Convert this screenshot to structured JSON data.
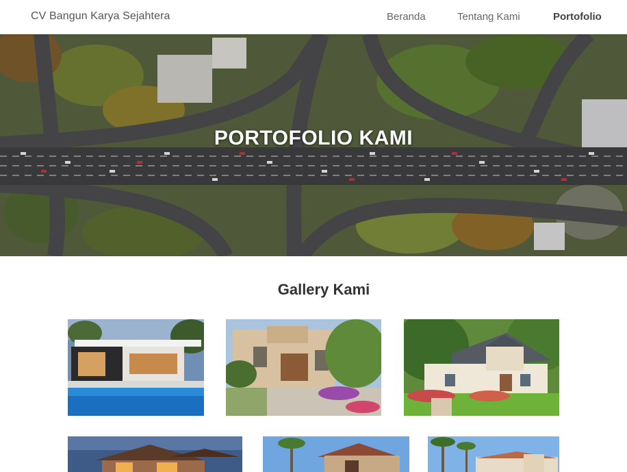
{
  "navbar": {
    "brand": "CV Bangun Karya Sejahtera",
    "links": [
      {
        "label": "Beranda",
        "active": false
      },
      {
        "label": "Tentang Kami",
        "active": false
      },
      {
        "label": "Portofolio",
        "active": true
      }
    ]
  },
  "hero": {
    "title": "PORTOFOLIO KAMI",
    "image": "aerial-highway-interchange-photo"
  },
  "gallery": {
    "title": "Gallery Kami",
    "images": [
      "modern-villa-pool-photo",
      "mediterranean-house-palm-photo",
      "colonial-house-lawn-photo",
      "modern-mansion-dusk-photo",
      "stone-house-palm-photo",
      "villa-palm-trees-photo"
    ]
  }
}
